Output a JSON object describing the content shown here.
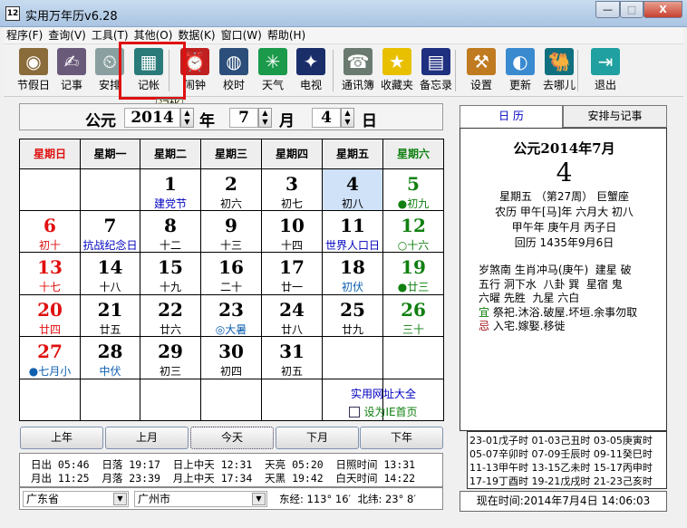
{
  "window": {
    "title": "实用万年历v6.28",
    "app_icon": "12",
    "minimize": "—",
    "maximize": "□",
    "close": "X"
  },
  "menu": [
    "程序(F)",
    "查询(V)",
    "工具(T)",
    "其他(O)",
    "数据(K)",
    "窗口(W)",
    "帮助(H)"
  ],
  "toolbar": [
    {
      "label": "节假日",
      "icon": "film-icon",
      "glyph": "◉",
      "color": "#8a6b3a"
    },
    {
      "label": "记事",
      "icon": "notebook-hand-icon",
      "glyph": "✍",
      "color": "#6a5a7a"
    },
    {
      "label": "安排",
      "icon": "schedule-clock-icon",
      "glyph": "⏲",
      "color": "#8aa0a0"
    },
    {
      "label": "记帐",
      "icon": "calculator-icon",
      "glyph": "▦",
      "color": "#2a7a7a"
    },
    {
      "label": "闹钟",
      "icon": "alarm-clock-icon",
      "glyph": "⏰",
      "color": "#c02020"
    },
    {
      "label": "校时",
      "icon": "globe-network-icon",
      "glyph": "◍",
      "color": "#2b4f7a"
    },
    {
      "label": "天气",
      "icon": "weather-icon",
      "glyph": "✳",
      "color": "#1a9a4a"
    },
    {
      "label": "电视",
      "icon": "tv-icon",
      "glyph": "✦",
      "color": "#1a2e6a"
    },
    {
      "label": "通讯簿",
      "icon": "phone-book-icon",
      "glyph": "☎",
      "color": "#6a7a70"
    },
    {
      "label": "收藏夹",
      "icon": "star-icon",
      "glyph": "★",
      "color": "#e8c000"
    },
    {
      "label": "备忘录",
      "icon": "memo-icon",
      "glyph": "▤",
      "color": "#203080"
    },
    {
      "label": "设置",
      "icon": "tools-icon",
      "glyph": "⚒",
      "color": "#c07a20"
    },
    {
      "label": "更新",
      "icon": "update-globe-icon",
      "glyph": "◐",
      "color": "#3a8ad0"
    },
    {
      "label": "去哪儿",
      "icon": "camel-icon",
      "glyph": "🐫",
      "color": "#107080"
    },
    {
      "label": "退出",
      "icon": "exit-door-icon",
      "glyph": "⇥",
      "color": "#20a0a0"
    }
  ],
  "tooltip": "记帐",
  "datebar": {
    "era": "公元",
    "year": "2014",
    "year_unit": "年",
    "month": "7",
    "month_unit": "月",
    "day": "4",
    "day_unit": "日"
  },
  "weekdays": [
    "星期日",
    "星期一",
    "星期二",
    "星期三",
    "星期四",
    "星期五",
    "星期六"
  ],
  "colors": {
    "sunday": "#e01010",
    "saturday": "#108010",
    "festival": "#0000c0",
    "term": "#1060b0",
    "normal": "#000000",
    "today_bg": "#cfe2f8"
  },
  "weeks": [
    [
      null,
      null,
      {
        "d": "1",
        "s": "建党节",
        "t": "festival"
      },
      {
        "d": "2",
        "s": "初六"
      },
      {
        "d": "3",
        "s": "初七"
      },
      {
        "d": "4",
        "s": "初八",
        "today": true
      },
      {
        "d": "5",
        "s": "●初九"
      }
    ],
    [
      {
        "d": "6",
        "s": "初十"
      },
      {
        "d": "7",
        "s": "抗战纪念日",
        "t": "festival"
      },
      {
        "d": "8",
        "s": "十二"
      },
      {
        "d": "9",
        "s": "十三"
      },
      {
        "d": "10",
        "s": "十四"
      },
      {
        "d": "11",
        "s": "世界人口日",
        "t": "festival"
      },
      {
        "d": "12",
        "s": "○十六"
      }
    ],
    [
      {
        "d": "13",
        "s": "十七"
      },
      {
        "d": "14",
        "s": "十八"
      },
      {
        "d": "15",
        "s": "十九"
      },
      {
        "d": "16",
        "s": "二十"
      },
      {
        "d": "17",
        "s": "廿一"
      },
      {
        "d": "18",
        "s": "初伏",
        "t": "term"
      },
      {
        "d": "19",
        "s": "●廿三"
      }
    ],
    [
      {
        "d": "20",
        "s": "廿四"
      },
      {
        "d": "21",
        "s": "廿五"
      },
      {
        "d": "22",
        "s": "廿六"
      },
      {
        "d": "23",
        "s": "◎大暑",
        "t": "term"
      },
      {
        "d": "24",
        "s": "廿八"
      },
      {
        "d": "25",
        "s": "廿九"
      },
      {
        "d": "26",
        "s": "三十"
      }
    ],
    [
      {
        "d": "27",
        "s": "●七月小",
        "t": "term"
      },
      {
        "d": "28",
        "s": "中伏",
        "t": "term"
      },
      {
        "d": "29",
        "s": "初三"
      },
      {
        "d": "30",
        "s": "初四"
      },
      {
        "d": "31",
        "s": "初五"
      },
      null,
      null
    ],
    [
      null,
      null,
      null,
      null,
      null,
      null,
      null
    ]
  ],
  "links": {
    "sites": "实用网址大全",
    "set_home": "设为IE首页"
  },
  "nav": [
    "上年",
    "上月",
    "今天",
    "下月",
    "下年"
  ],
  "sun_moon": {
    "row1": "日出 05:46  日落 19:17  日上中天 12:31  天亮 05:20  日照时间 13:31",
    "row2": "月出 11:25  月落 23:39  月上中天 17:34  天黑 19:42  白天时间 14:22"
  },
  "location": {
    "province": "广东省",
    "city": "广州市",
    "coords": "东经: 113° 16′  北纬: 23° 8′"
  },
  "tabs": [
    "日  历",
    "安排与记事"
  ],
  "detail": {
    "heading": "公元2014年7月",
    "day": "4",
    "line1": "星期五 （第27周） 巨蟹座",
    "line2": "农历 甲午[马]年 六月大 初八",
    "line3": "甲午年 庚午月 丙子日",
    "line4": "回历 1435年9月6日",
    "l5": "岁煞南 生肖冲马(庚午)  建星 破",
    "l6": "五行 洞下水  八卦 巽  星宿 鬼",
    "l7": "六曜 先胜  九星 六白",
    "yi_label": "宜",
    "yi": "祭祀.沐浴.破屋.坏垣.余事勿取",
    "ji_label": "忌",
    "ji": "入宅.嫁娶.移徙"
  },
  "hours": [
    "23-01戊子时 01-03己丑时 03-05庚寅时",
    "05-07辛卯时 07-09壬辰时 09-11癸巳时",
    "11-13甲午时 13-15乙未时 15-17丙申时",
    "17-19丁酉时 19-21戊戌时 21-23己亥时"
  ],
  "now": "现在时间:2014年7月4日  14:06:03"
}
